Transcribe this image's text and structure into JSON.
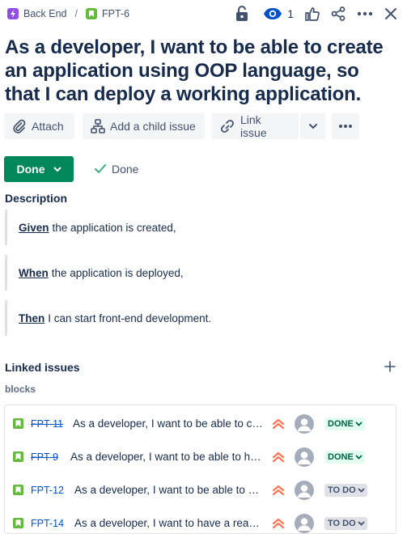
{
  "breadcrumb": {
    "parent": "Back End",
    "current": "FPT-6"
  },
  "header": {
    "watch_count": "1"
  },
  "title": "As a developer, I want to be able to create an application using OOP language, so that I can deploy a working application.",
  "actions": {
    "attach": "Attach",
    "add_child": "Add a child issue",
    "link_issue": "Link issue"
  },
  "status": {
    "label": "Done",
    "resolution": "Done"
  },
  "description": {
    "heading": "Description",
    "lines": [
      {
        "keyword": "Given",
        "text": "the application is created,"
      },
      {
        "keyword": "When",
        "text": "the application is deployed,"
      },
      {
        "keyword": "Then",
        "text": "I can start front-end development."
      }
    ]
  },
  "linked": {
    "heading": "Linked issues",
    "relation": "blocks",
    "issues": [
      {
        "key": "FPT-11",
        "summary": "As a developer, I want to be able to create...",
        "status": "DONE",
        "resolved": true
      },
      {
        "key": "FPT-9",
        "summary": "As a developer, I want to be able to have...",
        "status": "DONE",
        "resolved": true
      },
      {
        "key": "FPT-12",
        "summary": "As a developer, I want to be able to create...",
        "status": "TO DO",
        "resolved": false
      },
      {
        "key": "FPT-14",
        "summary": "As a developer, I want to have a readme...",
        "status": "TO DO",
        "resolved": false
      }
    ]
  },
  "colors": {
    "status_done": "#00875a",
    "link": "#0052cc",
    "priority": "#ff7452",
    "epic": "#904ee2",
    "story": "#63ba3c"
  }
}
